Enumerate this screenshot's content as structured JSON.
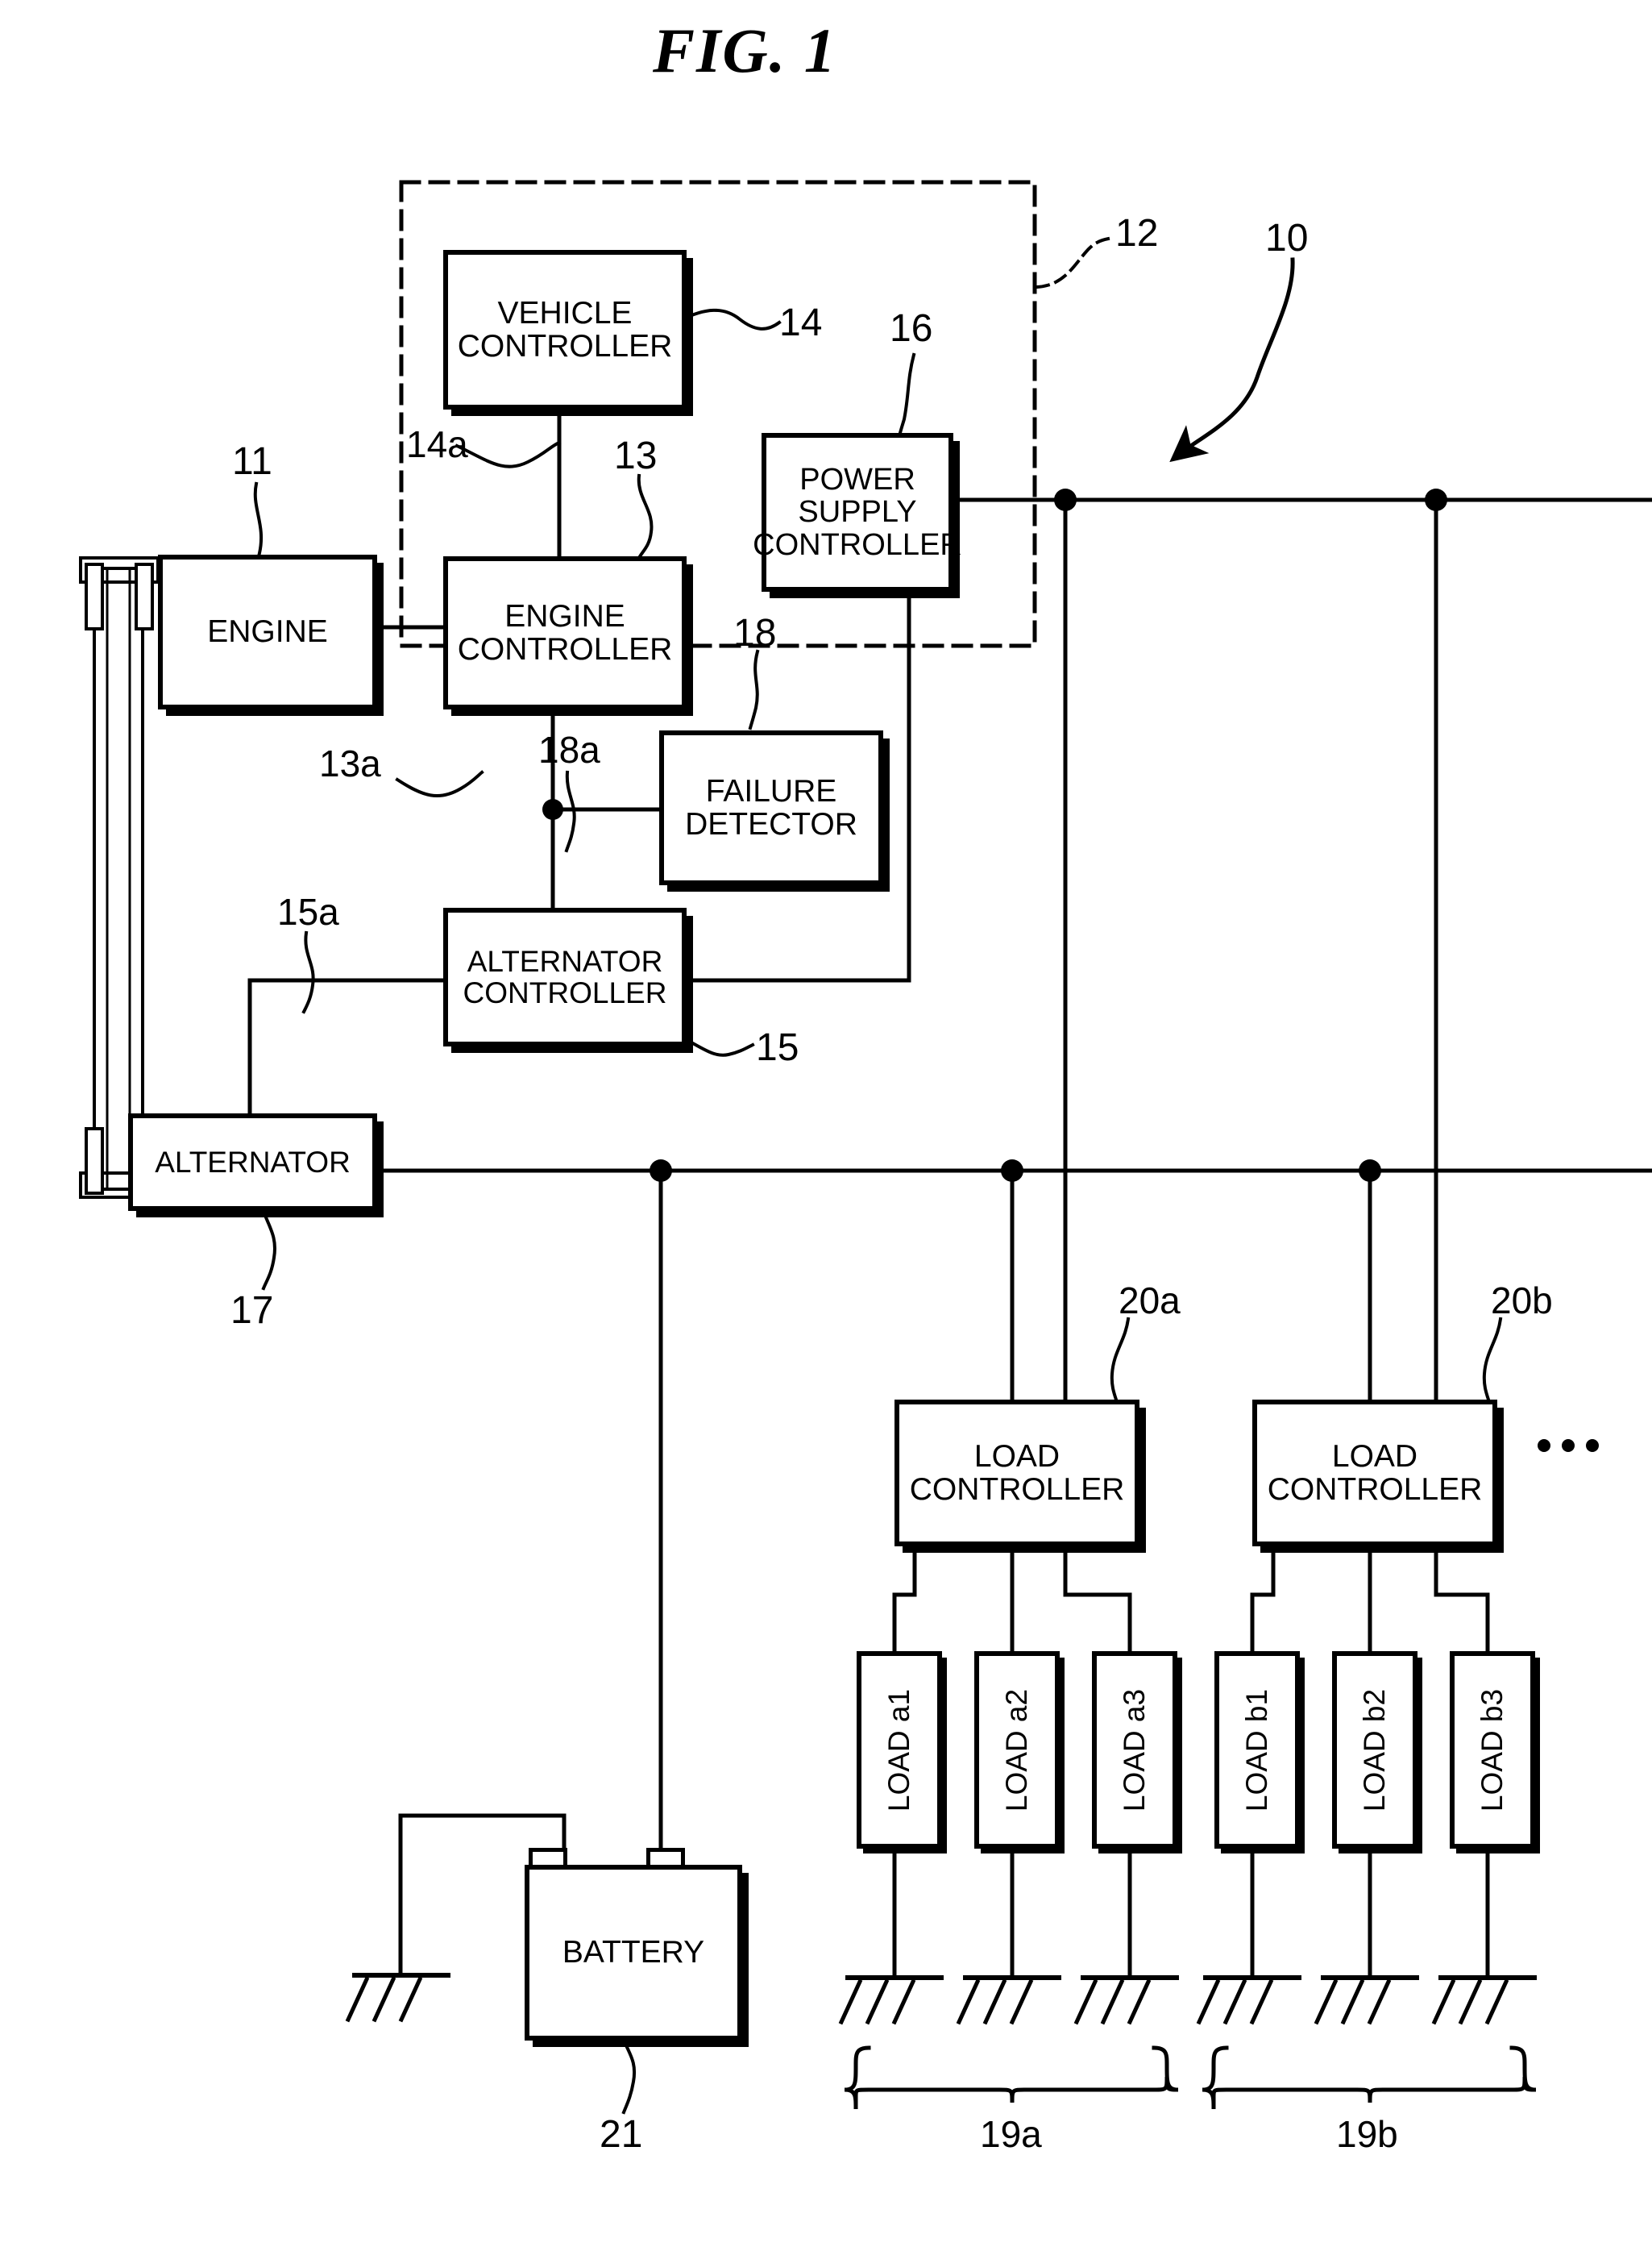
{
  "figure": {
    "title": "FIG.  1",
    "domain_note": "patent block diagram of a vehicle power supply system"
  },
  "blocks": {
    "vehicle_controller": {
      "label": "VEHICLE\nCONTROLLER",
      "ref": "14"
    },
    "engine": {
      "label": "ENGINE",
      "ref": "11"
    },
    "engine_controller": {
      "label": "ENGINE\nCONTROLLER",
      "ref": "13"
    },
    "power_supply_controller": {
      "label": "POWER\nSUPPLY\nCONTROLLER",
      "ref": "16"
    },
    "failure_detector": {
      "label": "FAILURE\nDETECTOR",
      "ref": "18"
    },
    "alternator_controller": {
      "label": "ALTERNATOR\nCONTROLLER",
      "ref": "15"
    },
    "alternator": {
      "label": "ALTERNATOR",
      "ref": "17"
    },
    "battery": {
      "label": "BATTERY",
      "ref": "21"
    },
    "load_controller_a": {
      "label": "LOAD\nCONTROLLER",
      "ref": "20a"
    },
    "load_controller_b": {
      "label": "LOAD\nCONTROLLER",
      "ref": "20b"
    }
  },
  "loads": [
    {
      "label": "LOAD a1",
      "group": "19a"
    },
    {
      "label": "LOAD a2",
      "group": "19a"
    },
    {
      "label": "LOAD a3",
      "group": "19a"
    },
    {
      "label": "LOAD b1",
      "group": "19b"
    },
    {
      "label": "LOAD b2",
      "group": "19b"
    },
    {
      "label": "LOAD b3",
      "group": "19b"
    }
  ],
  "groups": {
    "group_a": "19a",
    "group_b": "19b"
  },
  "refs": {
    "system": "10",
    "control_unit_dashed": "12",
    "engine": "11",
    "engine_controller": "13",
    "engine_controller_line": "13a",
    "vehicle_controller": "14",
    "vehicle_controller_line": "14a",
    "alternator_controller": "15",
    "alternator_controller_line": "15a",
    "power_supply_controller": "16",
    "alternator": "17",
    "failure_detector": "18",
    "failure_detector_line": "18a",
    "load_group_a": "19a",
    "load_group_b": "19b",
    "load_controller_a": "20a",
    "load_controller_b": "20b",
    "battery": "21"
  },
  "continuation": {
    "ellipsis": "· · ·"
  }
}
